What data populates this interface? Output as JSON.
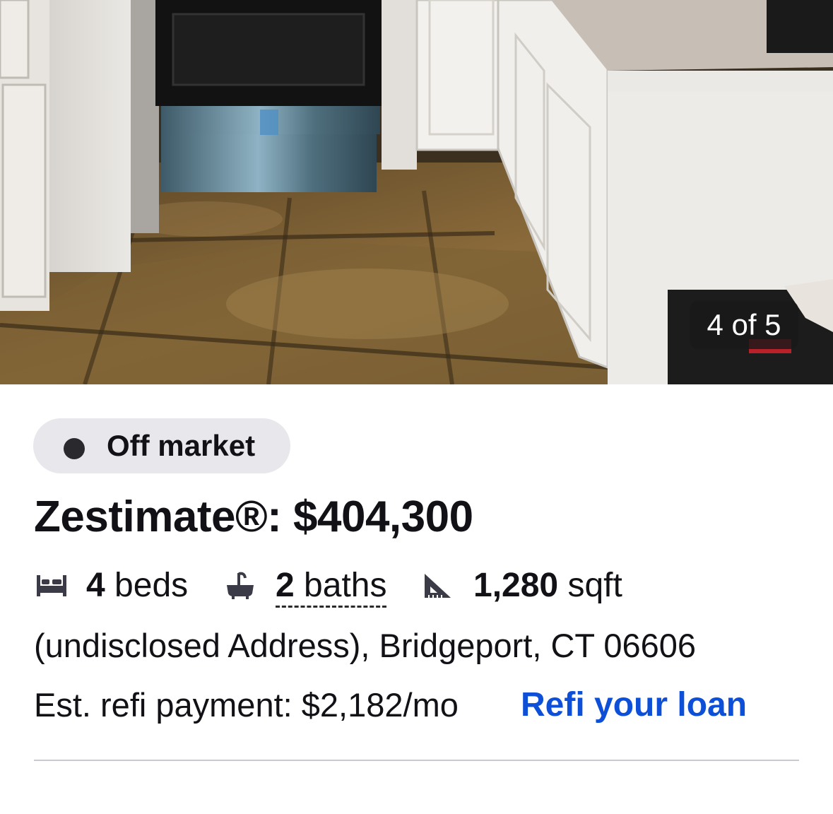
{
  "photo": {
    "counter": "4 of 5",
    "description_icon": "kitchen-photo"
  },
  "status": {
    "label": "Off market",
    "dot_color": "#2a2a2e"
  },
  "price": {
    "text": "Zestimate®: $404,300"
  },
  "facts": {
    "beds_value": "4",
    "beds_unit": "beds",
    "baths_value": "2",
    "baths_unit": "baths",
    "sqft_value": "1,280",
    "sqft_unit": "sqft",
    "icons": [
      "bed-icon",
      "bathtub-icon",
      "ruler-triangle-icon"
    ]
  },
  "address": "(undisclosed Address), Bridgeport, CT 06606",
  "refi": {
    "payment_text": "Est. refi payment: $2,182/mo",
    "link_label": "Refi your loan",
    "link_color": "#0d4fd6"
  }
}
